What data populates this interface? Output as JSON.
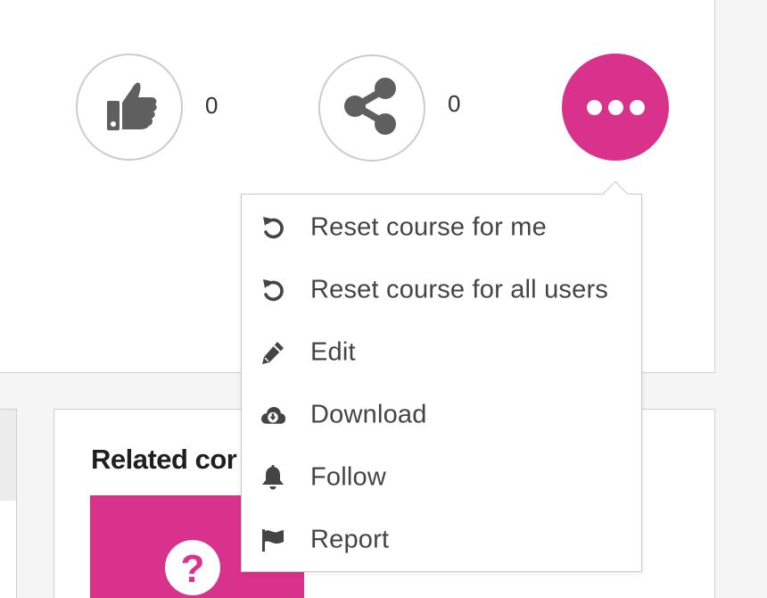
{
  "actions": {
    "like_count": "0",
    "share_count": "0"
  },
  "menu": {
    "items": [
      {
        "label": "Reset course for me",
        "icon": "reset-icon"
      },
      {
        "label": "Reset course for all users",
        "icon": "reset-icon"
      },
      {
        "label": "Edit",
        "icon": "pencil-icon"
      },
      {
        "label": "Download",
        "icon": "cloud-download-icon"
      },
      {
        "label": "Follow",
        "icon": "bell-icon"
      },
      {
        "label": "Report",
        "icon": "flag-icon"
      }
    ]
  },
  "related": {
    "title": "Related cor"
  },
  "colors": {
    "accent": "#d9328c",
    "icon_gray": "#5f5f5f",
    "border": "#cccccc"
  }
}
